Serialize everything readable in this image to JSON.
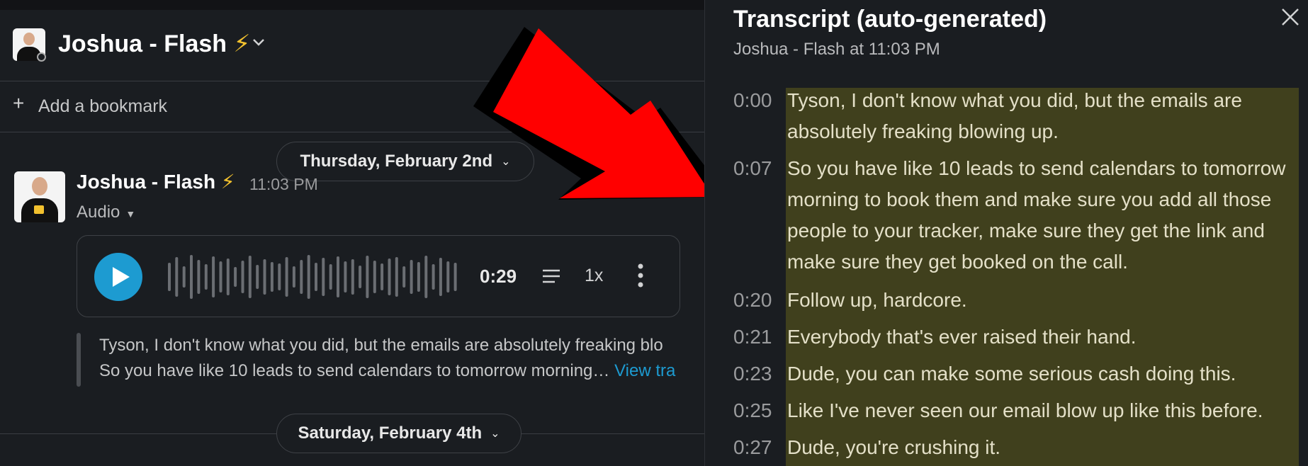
{
  "channel": {
    "title": "Joshua - Flash",
    "emoji": "⚡",
    "chevron_icon": "chevron-down-icon"
  },
  "bookmark": {
    "plus": "+",
    "label": "Add a bookmark"
  },
  "dates": {
    "first": "Thursday, February 2nd",
    "second": "Saturday, February 4th"
  },
  "message": {
    "sender": "Joshua - Flash",
    "emoji": "⚡",
    "time": "11:03 PM",
    "type_label": "Audio",
    "audio": {
      "duration": "0:29",
      "speed": "1x",
      "play_icon": "play-icon",
      "transcript_icon": "lines-icon",
      "more_icon": "more-vertical-icon"
    },
    "preview_line1": "Tyson, I don't know what you did, but the emails are absolutely freaking blo",
    "preview_line2": "So you have like 10 leads to send calendars to tomorrow morning… ",
    "view_link": "View tra"
  },
  "transcript_panel": {
    "title": "Transcript (auto-generated)",
    "subtitle": "Joshua - Flash at 11:03 PM",
    "close_icon": "close-icon",
    "highlight_color": "#40401d",
    "entries": [
      {
        "time": "0:00",
        "text": "Tyson, I don't know what you did, but the emails are absolutely freaking blowing up."
      },
      {
        "time": "0:07",
        "text": "So you have like 10 leads to send calendars to tomorrow morning to book them and make sure you add all those people to your tracker, make sure they get the link and make sure they get booked on the call."
      },
      {
        "time": "0:20",
        "text": "Follow up, hardcore."
      },
      {
        "time": "0:21",
        "text": "Everybody that's ever raised their hand."
      },
      {
        "time": "0:23",
        "text": "Dude, you can make some serious cash doing this."
      },
      {
        "time": "0:25",
        "text": "Like I've never seen our email blow up like this before."
      },
      {
        "time": "0:27",
        "text": "Dude, you're crushing it."
      }
    ]
  },
  "colors": {
    "accent": "#1d9bd1",
    "arrow": "#ff0000",
    "background": "#1a1d21"
  }
}
